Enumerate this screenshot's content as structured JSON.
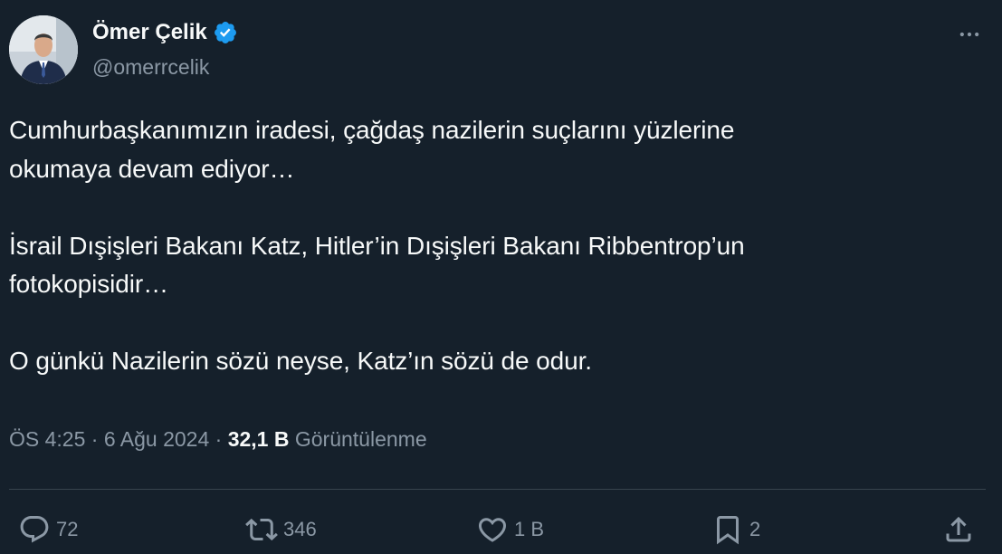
{
  "author": {
    "display_name": "Ömer Çelik",
    "handle": "@omerrcelik",
    "verified": true,
    "verified_color": "#1d9bf0"
  },
  "menu": {
    "icon": "more-horizontal-icon"
  },
  "tweet": {
    "text": "Cumhurbaşkanımızın iradesi, çağdaş nazilerin suçlarını yüzlerine\nokumaya devam ediyor…\n\nİsrail Dışişleri Bakanı Katz, Hitler’in Dışişleri Bakanı Ribbentrop’un\nfotokopisidir…\n\nO günkü Nazilerin sözü neyse, Katz’ın sözü de odur."
  },
  "meta": {
    "time": "ÖS 4:25",
    "separator": "·",
    "date": "6 Ağu 2024",
    "views_count": "32,1 B",
    "views_label": "Görüntülenme"
  },
  "actions": {
    "reply": {
      "icon": "reply-icon",
      "count": "72"
    },
    "retweet": {
      "icon": "retweet-icon",
      "count": "346"
    },
    "like": {
      "icon": "heart-icon",
      "count": "1 B"
    },
    "bookmark": {
      "icon": "bookmark-icon",
      "count": "2"
    },
    "share": {
      "icon": "share-icon"
    }
  },
  "colors": {
    "background": "#15202b",
    "text_primary": "#f7f9f9",
    "text_secondary": "#8b98a5",
    "divider": "#38444d"
  }
}
